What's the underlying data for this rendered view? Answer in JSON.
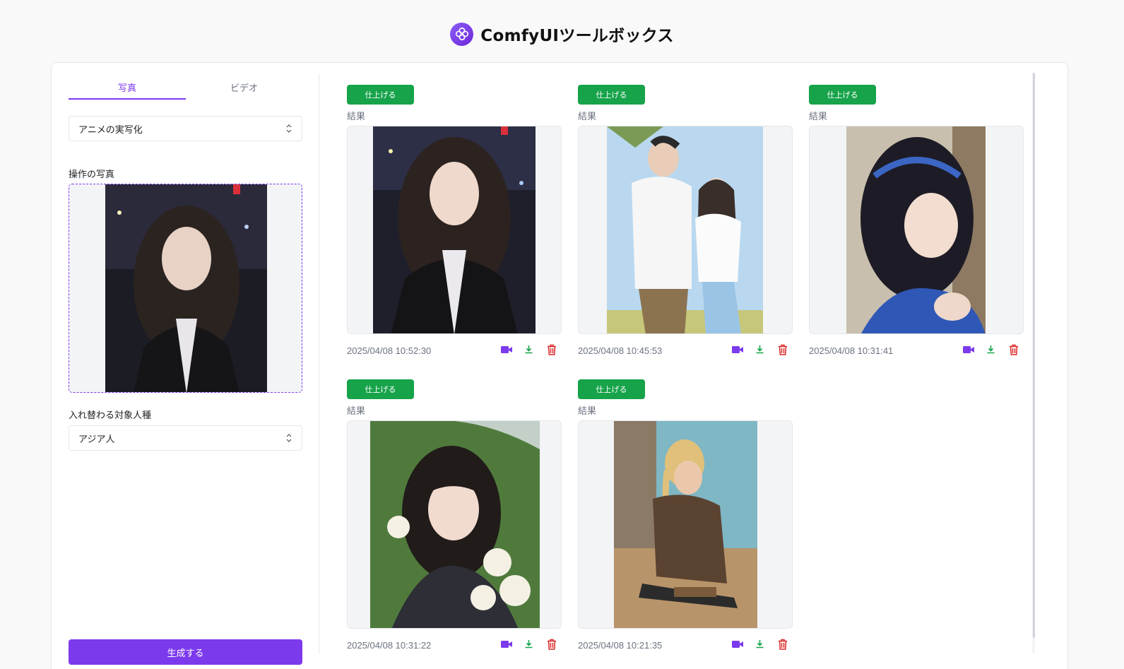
{
  "app": {
    "title": "ComfyUIツールボックス"
  },
  "tabs": [
    {
      "label": "写真",
      "active": true
    },
    {
      "label": "ビデオ",
      "active": false
    }
  ],
  "mode_select": {
    "value": "アニメの実写化"
  },
  "upload": {
    "label": "操作の写真"
  },
  "race_select": {
    "label": "入れ替わる対象人種",
    "value": "アジア人"
  },
  "generate_label": "生成する",
  "results": [
    {
      "finish_label": "仕上げる",
      "result_label": "結果",
      "timestamp": "2025/04/08 10:52:30"
    },
    {
      "finish_label": "仕上げる",
      "result_label": "結果",
      "timestamp": "2025/04/08 10:45:53"
    },
    {
      "finish_label": "仕上げる",
      "result_label": "結果",
      "timestamp": "2025/04/08 10:31:41"
    },
    {
      "finish_label": "仕上げる",
      "result_label": "結果",
      "timestamp": "2025/04/08 10:31:22"
    },
    {
      "finish_label": "仕上げる",
      "result_label": "結果",
      "timestamp": "2025/04/08 10:21:35"
    }
  ],
  "icons": [
    "video-icon",
    "download-icon",
    "trash-icon"
  ],
  "colors": {
    "accent": "#7c3aed",
    "finish": "#16a34a",
    "delete": "#dc2626",
    "download": "#16a34a"
  }
}
